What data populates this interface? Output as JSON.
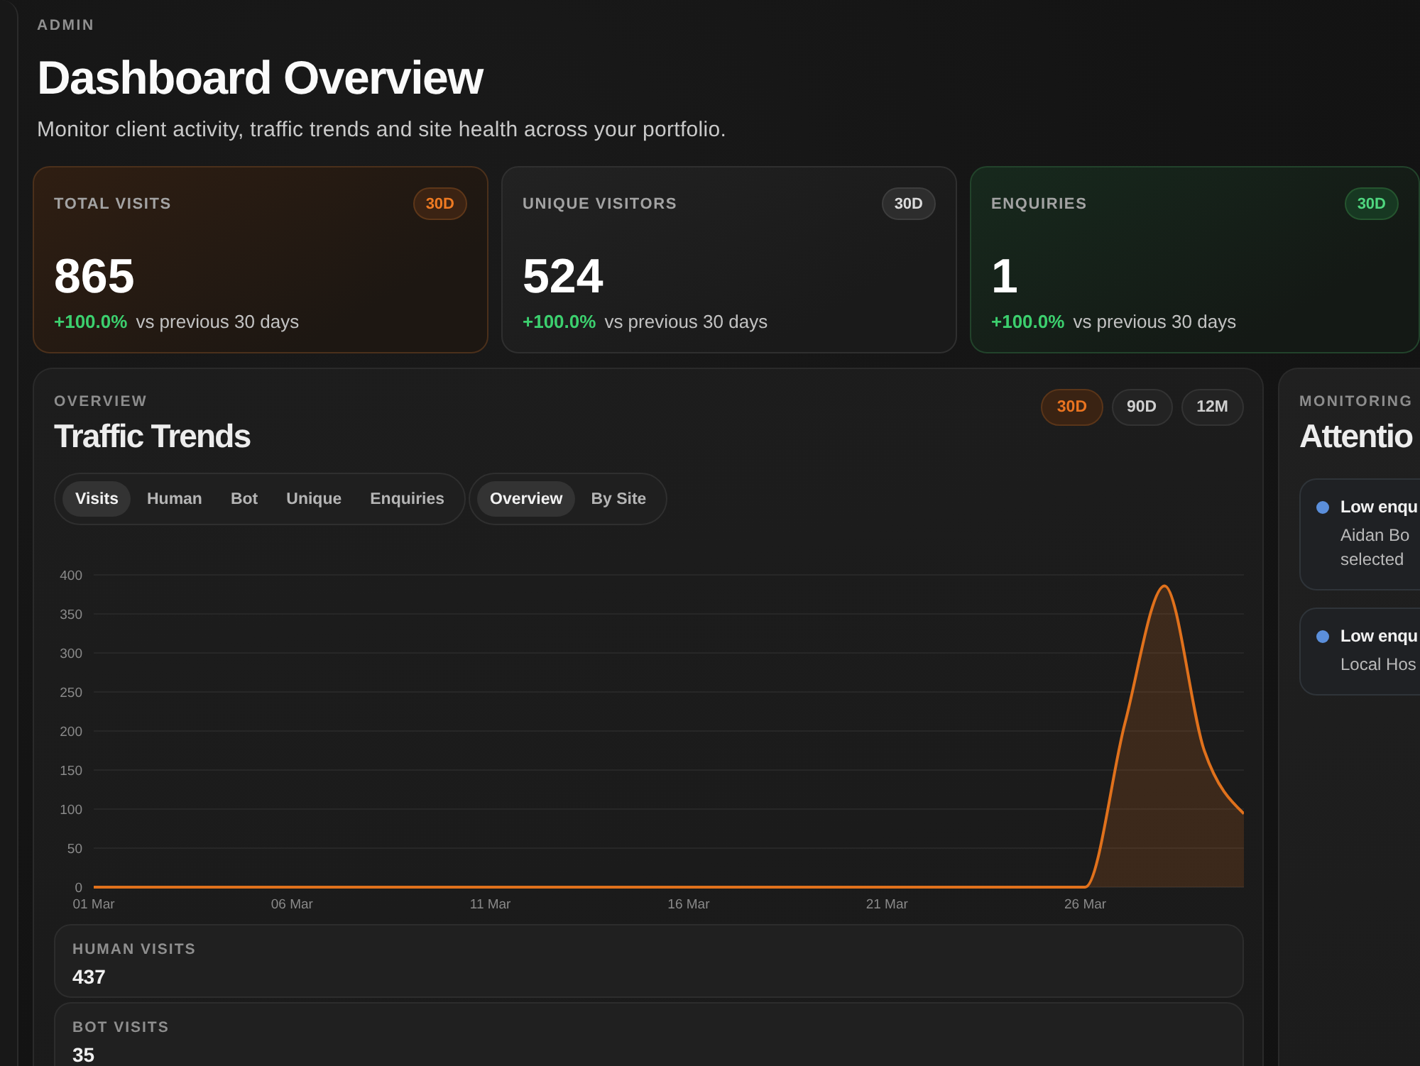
{
  "header": {
    "eyebrow": "ADMIN",
    "title": "Dashboard Overview",
    "subtitle": "Monitor client activity, traffic trends and site health across your portfolio."
  },
  "stat_cards": [
    {
      "kind": "primary",
      "label": "TOTAL VISITS",
      "badge": "30D",
      "value": "865",
      "change": "+100.0%",
      "comparison": "vs previous 30 days"
    },
    {
      "kind": "neutral",
      "label": "UNIQUE VISITORS",
      "badge": "30D",
      "value": "524",
      "change": "+100.0%",
      "comparison": "vs previous 30 days"
    },
    {
      "kind": "positive",
      "label": "ENQUIRIES",
      "badge": "30D",
      "value": "1",
      "change": "+100.0%",
      "comparison": "vs previous 30 days"
    }
  ],
  "traffic": {
    "eyebrow": "OVERVIEW",
    "title": "Traffic Trends",
    "ranges": [
      {
        "label": "30D",
        "selected": true
      },
      {
        "label": "90D",
        "selected": false
      },
      {
        "label": "12M",
        "selected": false
      }
    ],
    "metric_tabs": [
      {
        "label": "Visits",
        "selected": true
      },
      {
        "label": "Human",
        "selected": false
      },
      {
        "label": "Bot",
        "selected": false
      },
      {
        "label": "Unique",
        "selected": false
      },
      {
        "label": "Enquiries",
        "selected": false
      }
    ],
    "view_tabs": [
      {
        "label": "Overview",
        "selected": true
      },
      {
        "label": "By Site",
        "selected": false
      }
    ],
    "chart_data": {
      "type": "area",
      "grid": true,
      "categories": [
        "01 Mar",
        null,
        null,
        null,
        null,
        "06 Mar",
        null,
        null,
        null,
        null,
        "11 Mar",
        null,
        null,
        null,
        null,
        "16 Mar",
        null,
        null,
        null,
        null,
        "21 Mar",
        null,
        null,
        null,
        null,
        "26 Mar",
        null,
        null,
        null,
        null
      ],
      "ylim": [
        0,
        400
      ],
      "yticks": [
        0,
        50,
        100,
        150,
        200,
        250,
        300,
        350,
        400
      ],
      "series": [
        {
          "color": "#e0711c",
          "values": [
            0,
            0,
            0,
            0,
            0,
            0,
            0,
            0,
            0,
            0,
            0,
            0,
            0,
            0,
            0,
            0,
            0,
            0,
            0,
            0,
            0,
            0,
            0,
            0,
            0,
            0,
            210,
            386,
            175,
            94
          ]
        }
      ]
    },
    "breakdown": [
      {
        "label": "HUMAN VISITS",
        "value": "437"
      },
      {
        "label": "BOT VISITS",
        "value": "35"
      }
    ]
  },
  "monitoring": {
    "eyebrow": "MONITORING",
    "title": "Attentio",
    "alerts": [
      {
        "color": "#5b8fdb",
        "title": "Low enqu",
        "description": [
          "Aidan Bo",
          "selected"
        ]
      },
      {
        "color": "#5b8fdb",
        "title": "Low enqu",
        "description": [
          "Local Hos"
        ]
      }
    ]
  }
}
